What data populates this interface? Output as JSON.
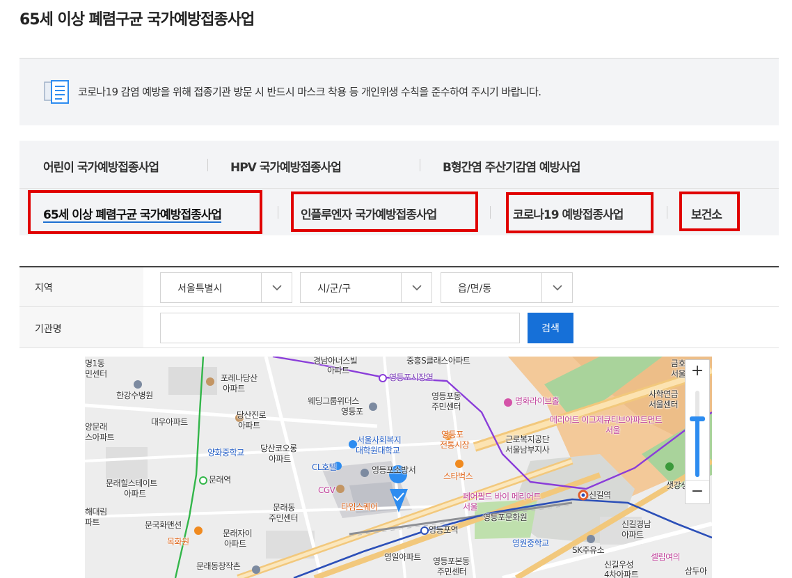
{
  "page": {
    "title": "65세 이상 폐렴구균 국가예방접종사업"
  },
  "notice": {
    "text": "코로나19 감염 예방을 위해 접종기관 방문 시 반드시 마스크 착용 등 개인위생 수칙을 준수하여 주시기 바랍니다."
  },
  "tabs": {
    "row1": [
      "어린이 국가예방접종사업",
      "HPV 국가예방접종사업",
      "B형간염 주산기감염 예방사업"
    ],
    "row2": [
      "65세 이상 폐렴구균 국가예방접종사업",
      "인플루엔자 국가예방접종사업",
      "코로나19 예방접종사업",
      "보건소"
    ],
    "active": "65세 이상 폐렴구균 국가예방접종사업",
    "highlight_color": "#e00000"
  },
  "search": {
    "region_label": "지역",
    "sido_value": "서울특별시",
    "sigungu_value": "시/군/구",
    "dong_value": "읍/면/동",
    "org_label": "기관명",
    "org_placeholder": "",
    "search_button": "검색",
    "button_color": "#1670d8"
  },
  "map": {
    "zoom_in": "+",
    "zoom_out": "−",
    "zoom_level": 0.62,
    "labels": {
      "l1": "명1동",
      "l2": "민센터",
      "l3": "한강수병원",
      "l4": "포레나당산",
      "l5": "아파트",
      "l6": "경남아너스빌",
      "l7": "아파트",
      "l8": "영등포시장역",
      "l9": "중흥S클래스아파트",
      "l10": "웨딩그룹위더스",
      "l11": "영등포",
      "l12": "영등포동",
      "l13": "주민센터",
      "l14": "명화라이브홀",
      "l15": "금호",
      "l16": "서울",
      "l17": "사학연금",
      "l18": "서울센터",
      "l19": "메리어트 이그제큐티브아파트먼트",
      "l20": "서울",
      "l21": "양문래",
      "l22": "스아파트",
      "l23": "대우아파트",
      "l24": "당산진로",
      "l25": "아파트",
      "l26": "서울사회복지",
      "l27": "대학원대학교",
      "l28": "영등포",
      "l29": "전통시장",
      "l30": "근로복지공단",
      "l31": "서울남부지사",
      "l32": "양화중학교",
      "l33": "당산코오롱",
      "l34": "아파트",
      "l35": "CL호텔",
      "l36": "영등포소방서",
      "l37": "스타벅스",
      "l38": "문래역",
      "l39": "문래힐스테이트",
      "l40": "아파트",
      "l41": "CGV",
      "l42": "타임스퀘어",
      "l43": "페어필드 바이 메리어트",
      "l44": "서울",
      "l45": "신길역",
      "l46": "샛강생태공",
      "l47": "해대림",
      "l48": "파트",
      "l49": "문래동",
      "l50": "주민센터",
      "l51": "문국화맨션",
      "l52": "영등포문화원",
      "l53": "신길경남",
      "l54": "아파트",
      "l55": "문래자이",
      "l56": "아파트",
      "l57": "목화원",
      "l58": "영등포역",
      "l59": "영원중학교",
      "l60": "SK주유소",
      "l61": "문래동창작촌",
      "l62": "영일아파트",
      "l63": "영등포본동",
      "l64": "주민센터",
      "l65": "신길우성",
      "l66": "4차아파트",
      "l67": "셀립여의",
      "l68": "삼두아",
      "l69": "파트"
    }
  }
}
